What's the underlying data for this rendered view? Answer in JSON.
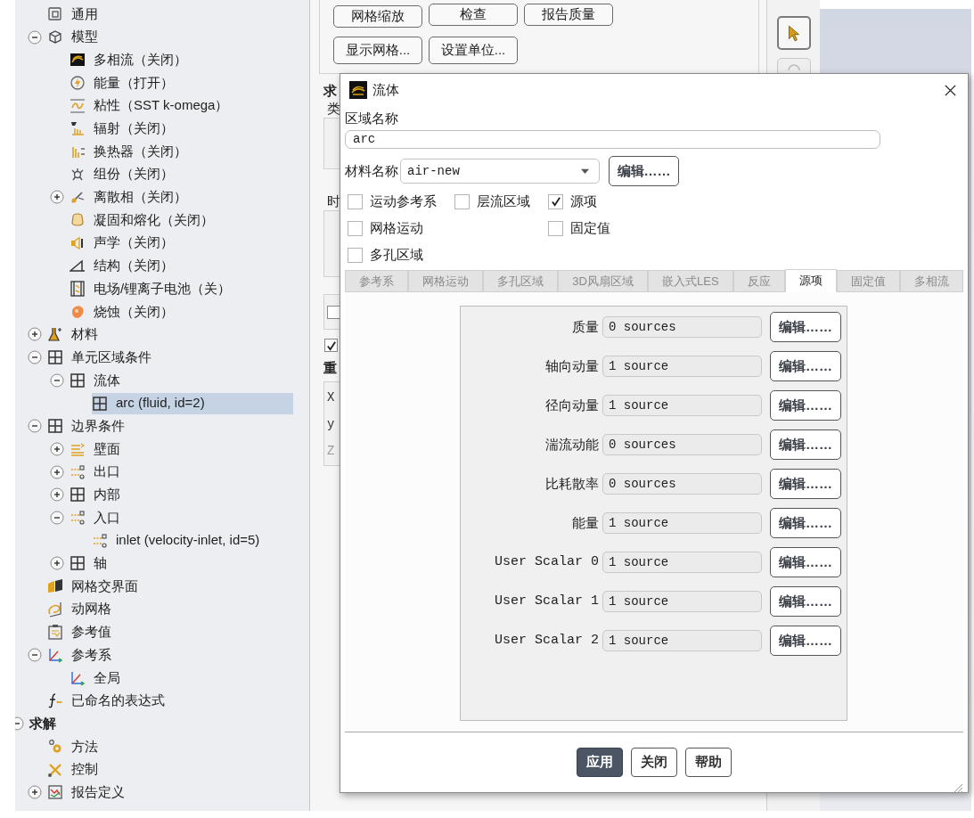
{
  "tree": [
    {
      "kind": "group",
      "children": [
        {
          "label": "通用",
          "selected": false
        },
        {
          "label": "模型",
          "expanded": true,
          "selected": false,
          "children": [
            {
              "label": "多相流（关闭）",
              "selected": false
            },
            {
              "label": "能量（打开）",
              "selected": false
            },
            {
              "label": "粘性（SST k-omega）",
              "selected": false
            },
            {
              "label": "辐射（关闭）",
              "selected": false
            },
            {
              "label": "换热器（关闭）",
              "selected": false
            },
            {
              "label": "组份（关闭）",
              "selected": false
            },
            {
              "label": "离散相（关闭）",
              "expanded": false,
              "selected": false
            },
            {
              "label": "凝固和熔化（关闭）",
              "selected": false
            },
            {
              "label": "声学（关闭）",
              "selected": false
            },
            {
              "label": "结构（关闭）",
              "selected": false
            },
            {
              "label": "电场/锂离子电池（关）",
              "selected": false
            },
            {
              "label": "烧蚀（关闭）",
              "selected": false
            }
          ]
        },
        {
          "label": "材料",
          "expanded": false,
          "selected": false
        },
        {
          "label": "单元区域条件",
          "expanded": true,
          "selected": false,
          "children": [
            {
              "label": "流体",
              "expanded": true,
              "selected": false,
              "children": [
                {
                  "label": "arc (fluid, id=2)",
                  "selected": true
                }
              ]
            }
          ]
        },
        {
          "label": "边界条件",
          "expanded": true,
          "selected": false,
          "children": [
            {
              "label": "壁面",
              "expanded": false,
              "selected": false
            },
            {
              "label": "出口",
              "expanded": false,
              "selected": false
            },
            {
              "label": "内部",
              "expanded": false,
              "selected": false
            },
            {
              "label": "入口",
              "expanded": true,
              "selected": false,
              "children": [
                {
                  "label": "inlet (velocity-inlet, id=5)",
                  "selected": false
                }
              ]
            },
            {
              "label": "轴",
              "expanded": false,
              "selected": false
            }
          ]
        },
        {
          "label": "网格交界面",
          "selected": false
        },
        {
          "label": "动网格",
          "selected": false
        },
        {
          "label": "参考值",
          "selected": false
        },
        {
          "label": "参考系",
          "expanded": true,
          "selected": false,
          "children": [
            {
              "label": "全局",
              "selected": false
            }
          ]
        },
        {
          "label": "已命名的表达式",
          "selected": false
        }
      ]
    },
    {
      "kind": "section",
      "label": "求解",
      "expanded": true,
      "selected": false,
      "children": [
        {
          "label": "方法",
          "selected": false
        },
        {
          "label": "控制",
          "selected": false
        },
        {
          "label": "报告定义",
          "expanded": false,
          "selected": false
        }
      ]
    }
  ],
  "background_panel": {
    "buttons": [
      "网格缩放",
      "检查",
      "报告质量",
      "显示网格...",
      "设置单位..."
    ],
    "items": [
      {
        "kind": "heading",
        "text": "求"
      },
      {
        "kind": "label",
        "text": "类"
      },
      {
        "kind": "frame"
      },
      {
        "kind": "label",
        "text": "时"
      },
      {
        "kind": "frame"
      },
      {
        "kind": "frame-checkbox",
        "checked": false
      },
      {
        "kind": "checkbox",
        "checked": true
      },
      {
        "kind": "heading",
        "text": "重"
      },
      {
        "kind": "coords",
        "texts": [
          "X",
          "y",
          "Z"
        ]
      }
    ]
  },
  "toolbar": [
    {
      "selected": true
    },
    {
      "selected": false
    }
  ],
  "dialog": {
    "title": "流体",
    "zone_name_label": "区域名称",
    "zone_name": "arc",
    "material_label": "材料名称",
    "material": "air-new",
    "material_edit": "编辑……",
    "option_columns": [
      [
        {
          "label": "运动参考系",
          "checked": false
        },
        {
          "label": "网格运动",
          "checked": false
        },
        {
          "label": "多孔区域",
          "checked": false
        }
      ],
      [
        {
          "label": "层流区域",
          "checked": false
        }
      ],
      [
        {
          "label": "源项",
          "checked": true
        },
        {
          "label": "固定值",
          "checked": false
        }
      ]
    ],
    "tabs": [
      {
        "label": "参考系",
        "selected": false
      },
      {
        "label": "网格运动",
        "selected": false
      },
      {
        "label": "多孔区域",
        "selected": false
      },
      {
        "label": "3D风扇区域",
        "selected": false
      },
      {
        "label": "嵌入式LES",
        "selected": false
      },
      {
        "label": "反应",
        "selected": false
      },
      {
        "label": "源项",
        "selected": true
      },
      {
        "label": "固定值",
        "selected": false
      },
      {
        "label": "多相流",
        "selected": false
      }
    ],
    "sources": [
      {
        "label": "质量",
        "value": "0 sources",
        "button": "编辑……"
      },
      {
        "label": "轴向动量",
        "value": "1 source",
        "button": "编辑……"
      },
      {
        "label": "径向动量",
        "value": "1 source",
        "button": "编辑……"
      },
      {
        "label": "湍流动能",
        "value": "0 sources",
        "button": "编辑……"
      },
      {
        "label": "比耗散率",
        "value": "0 sources",
        "button": "编辑……"
      },
      {
        "label": "能量",
        "value": "1 source",
        "button": "编辑……"
      },
      {
        "label": "User Scalar 0",
        "value": "1 source",
        "button": "编辑……"
      },
      {
        "label": "User Scalar 1",
        "value": "1 source",
        "button": "编辑……"
      },
      {
        "label": "User Scalar 2",
        "value": "1 source",
        "button": "编辑……"
      }
    ],
    "buttons": [
      {
        "label": "应用",
        "primary": true
      },
      {
        "label": "关闭",
        "primary": false
      },
      {
        "label": "帮助",
        "primary": false
      }
    ]
  }
}
